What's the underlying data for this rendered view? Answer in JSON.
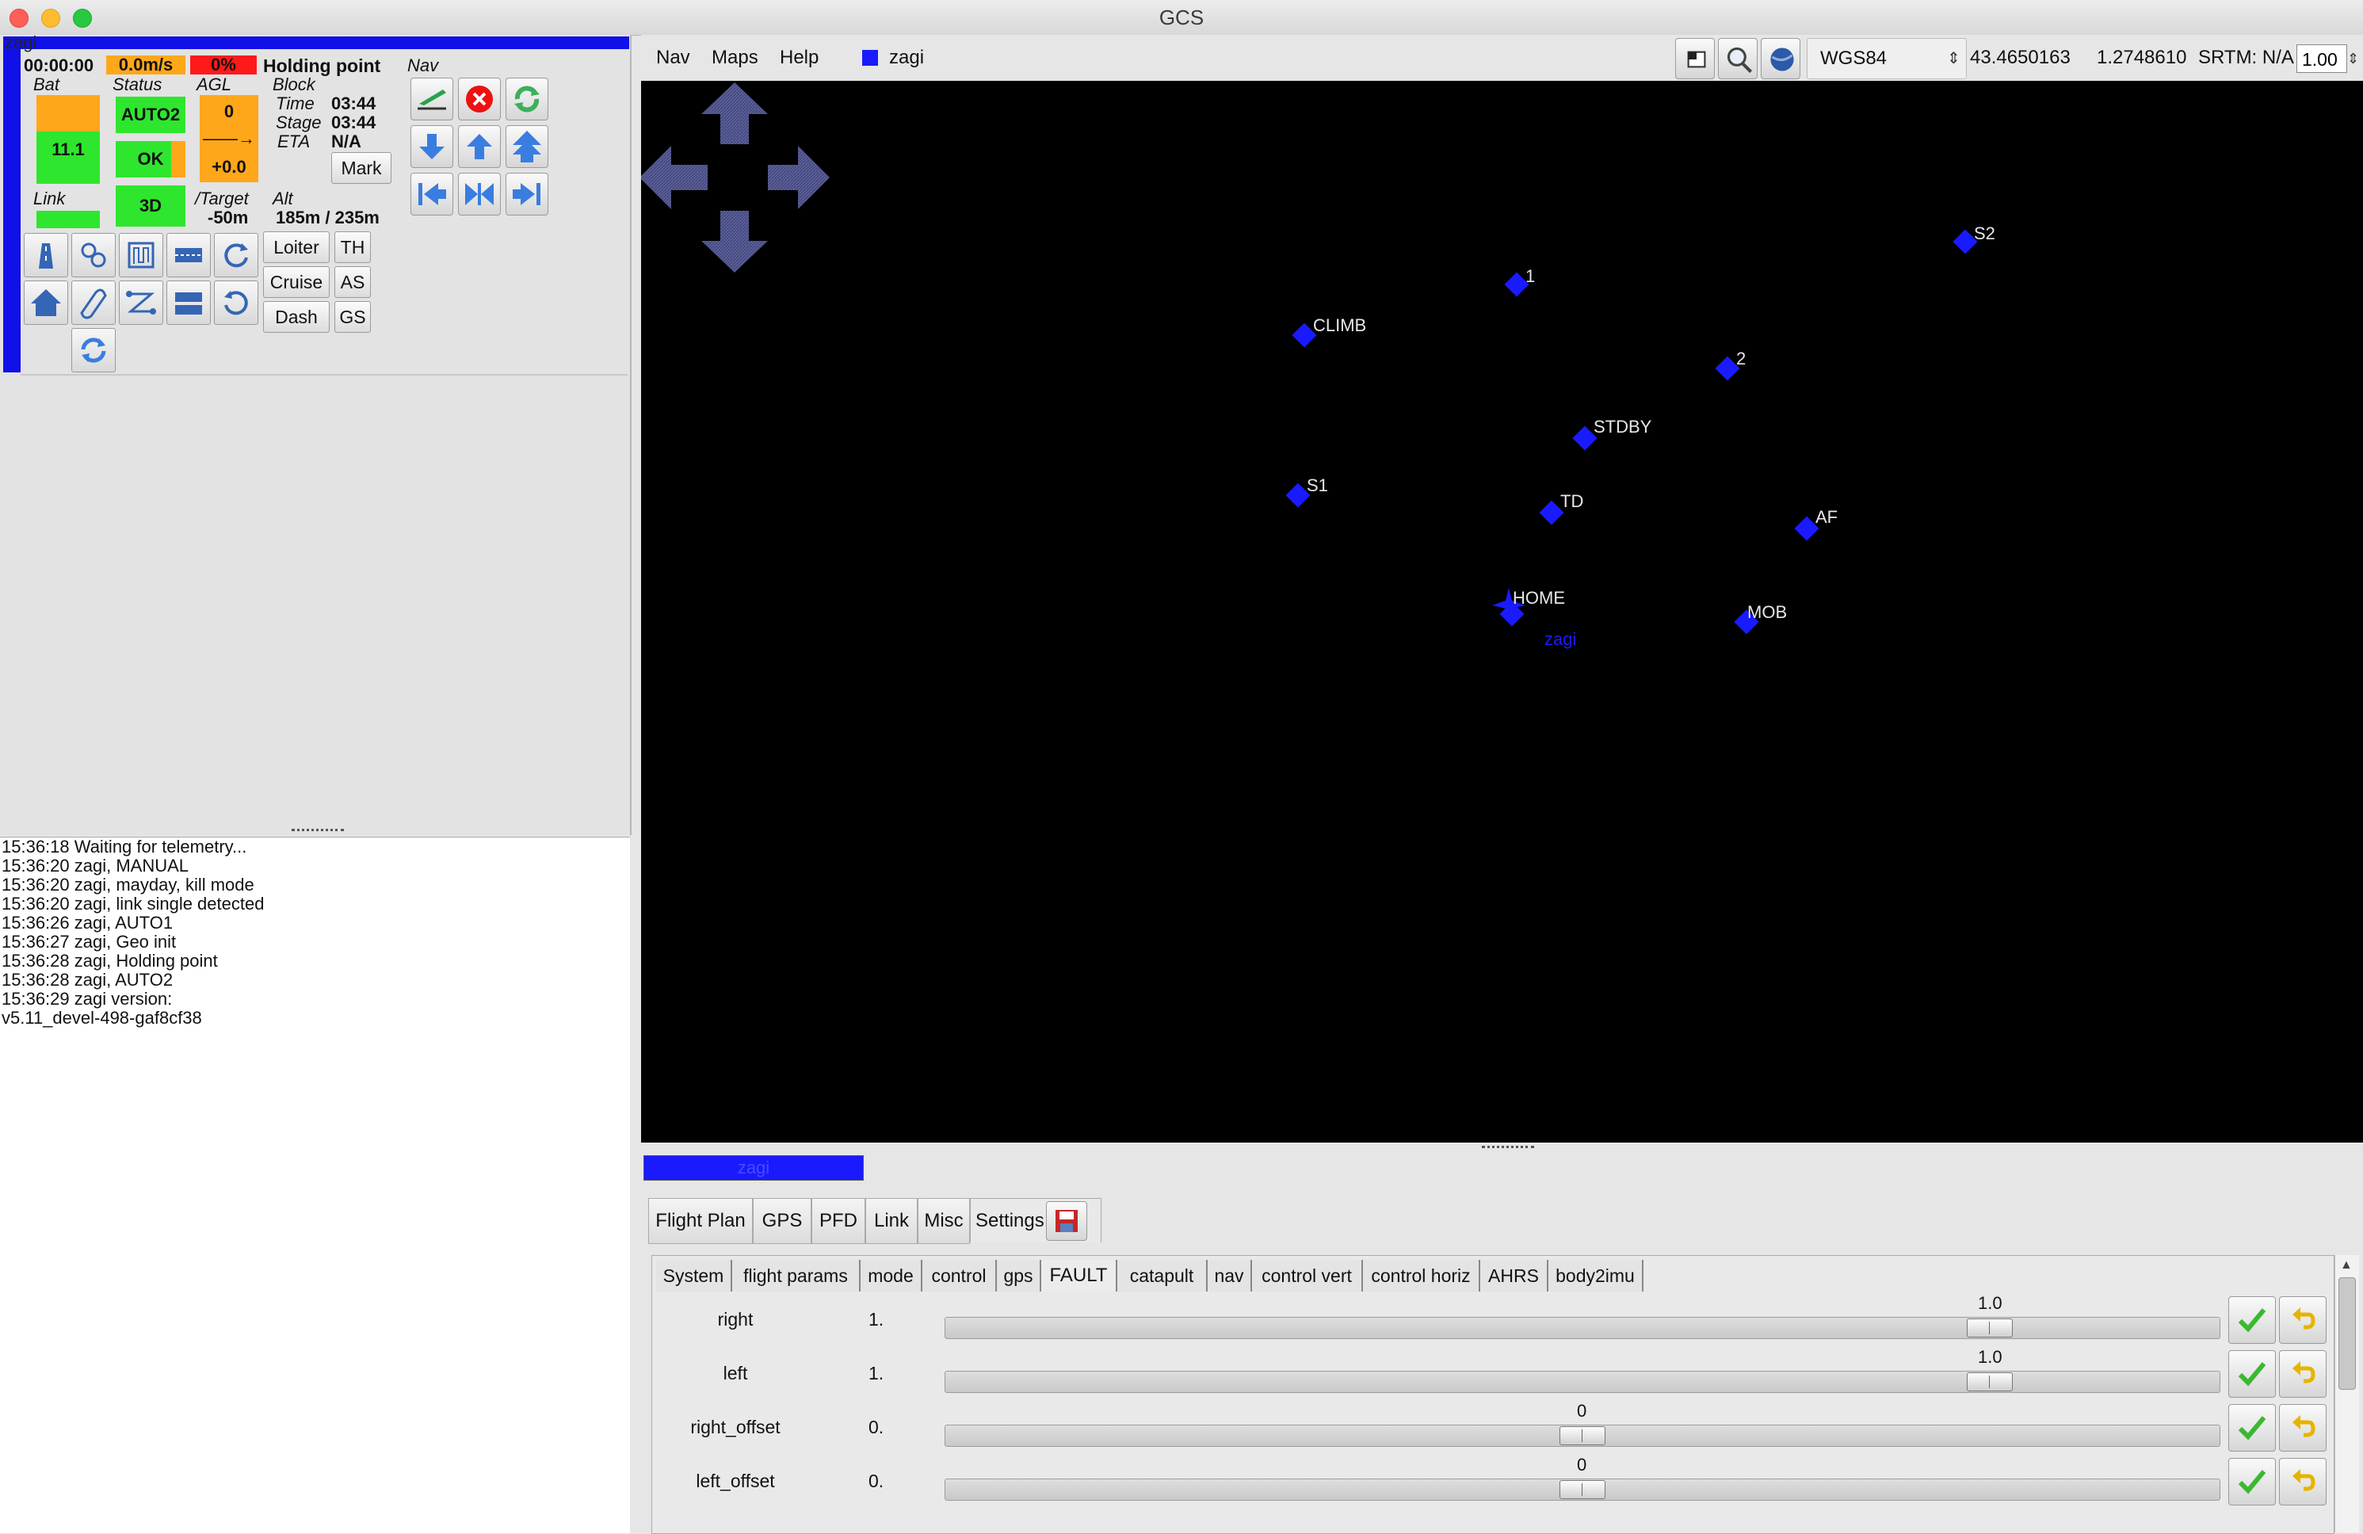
{
  "window": {
    "title": "GCS"
  },
  "aircraft": {
    "label": "zagi",
    "time": "00:00:00",
    "speed": "0.0m/s",
    "throttle": "0%",
    "block_name": "Holding point",
    "nav_label": "Nav",
    "bat_label": "Bat",
    "bat_value": "11.1",
    "status_label": "Status",
    "status_mode": "AUTO2",
    "status_ok": "OK",
    "status_gps": "3D",
    "agl_label": "AGL",
    "agl_value": "0",
    "agl_arrow": "——→",
    "agl_delta": "+0.0",
    "block_label": "Block",
    "time_label": "Time",
    "time_value": "03:44",
    "stage_label": "Stage",
    "stage_value": "03:44",
    "eta_label": "ETA",
    "eta_value": "N/A",
    "mark_label": "Mark",
    "link_label": "Link",
    "target_label": "/Target",
    "target_value": "-50m",
    "alt_label": "Alt",
    "alt_value": "185m / 235m",
    "speed_buttons": {
      "loiter": "Loiter",
      "cruise": "Cruise",
      "dash": "Dash",
      "th": "TH",
      "as": "AS",
      "gs": "GS"
    },
    "colors": {
      "ok": "#2ee62e",
      "warn": "#ffa71a",
      "alert": "#ff1a1a",
      "strip": "#1010e8"
    }
  },
  "console": {
    "lines": [
      "15:36:18 Waiting for telemetry...",
      "15:36:20 zagi, MANUAL",
      "15:36:20 zagi, mayday, kill mode",
      "15:36:20 zagi, link single detected",
      "15:36:26 zagi, AUTO1",
      "15:36:27 zagi, Geo init",
      "15:36:28 zagi, Holding point",
      "15:36:28 zagi, AUTO2",
      "15:36:29 zagi version:",
      "v5.11_devel-498-gaf8cf38"
    ]
  },
  "map_toolbar": {
    "menu_nav": "Nav",
    "menu_maps": "Maps",
    "menu_help": "Help",
    "aircraft": "zagi",
    "projection": "WGS84",
    "lat": "43.4650163",
    "lon": "1.2748610",
    "srtm": "SRTM: N/A",
    "zoom": "1.00"
  },
  "map": {
    "waypoints": [
      {
        "id": "S2",
        "label": "S2"
      },
      {
        "id": "1",
        "label": "1"
      },
      {
        "id": "CLIMB",
        "label": "CLIMB"
      },
      {
        "id": "2",
        "label": "2"
      },
      {
        "id": "STDBY",
        "label": "STDBY"
      },
      {
        "id": "S1",
        "label": "S1"
      },
      {
        "id": "TD",
        "label": "TD"
      },
      {
        "id": "AF",
        "label": "AF"
      },
      {
        "id": "HOME",
        "label": "HOME"
      },
      {
        "id": "MOB",
        "label": "MOB"
      }
    ],
    "aircraft_label": "zagi"
  },
  "notebook": {
    "ac_tab": "zagi",
    "tabs": [
      "Flight Plan",
      "GPS",
      "PFD",
      "Link",
      "Misc",
      "Settings"
    ],
    "settings_tabs": [
      "System",
      "flight params",
      "mode",
      "control",
      "gps",
      "FAULT",
      "catapult",
      "nav",
      "control vert",
      "control horiz",
      "AHRS",
      "body2imu"
    ],
    "rows": [
      {
        "name": "right",
        "value": "1.",
        "slider_value": "1.0",
        "fraction": 0.83
      },
      {
        "name": "left",
        "value": "1.",
        "slider_value": "1.0",
        "fraction": 0.83
      },
      {
        "name": "right_offset",
        "value": "0.",
        "slider_value": "0",
        "fraction": 0.5
      },
      {
        "name": "left_offset",
        "value": "0.",
        "slider_value": "0",
        "fraction": 0.5
      }
    ]
  }
}
